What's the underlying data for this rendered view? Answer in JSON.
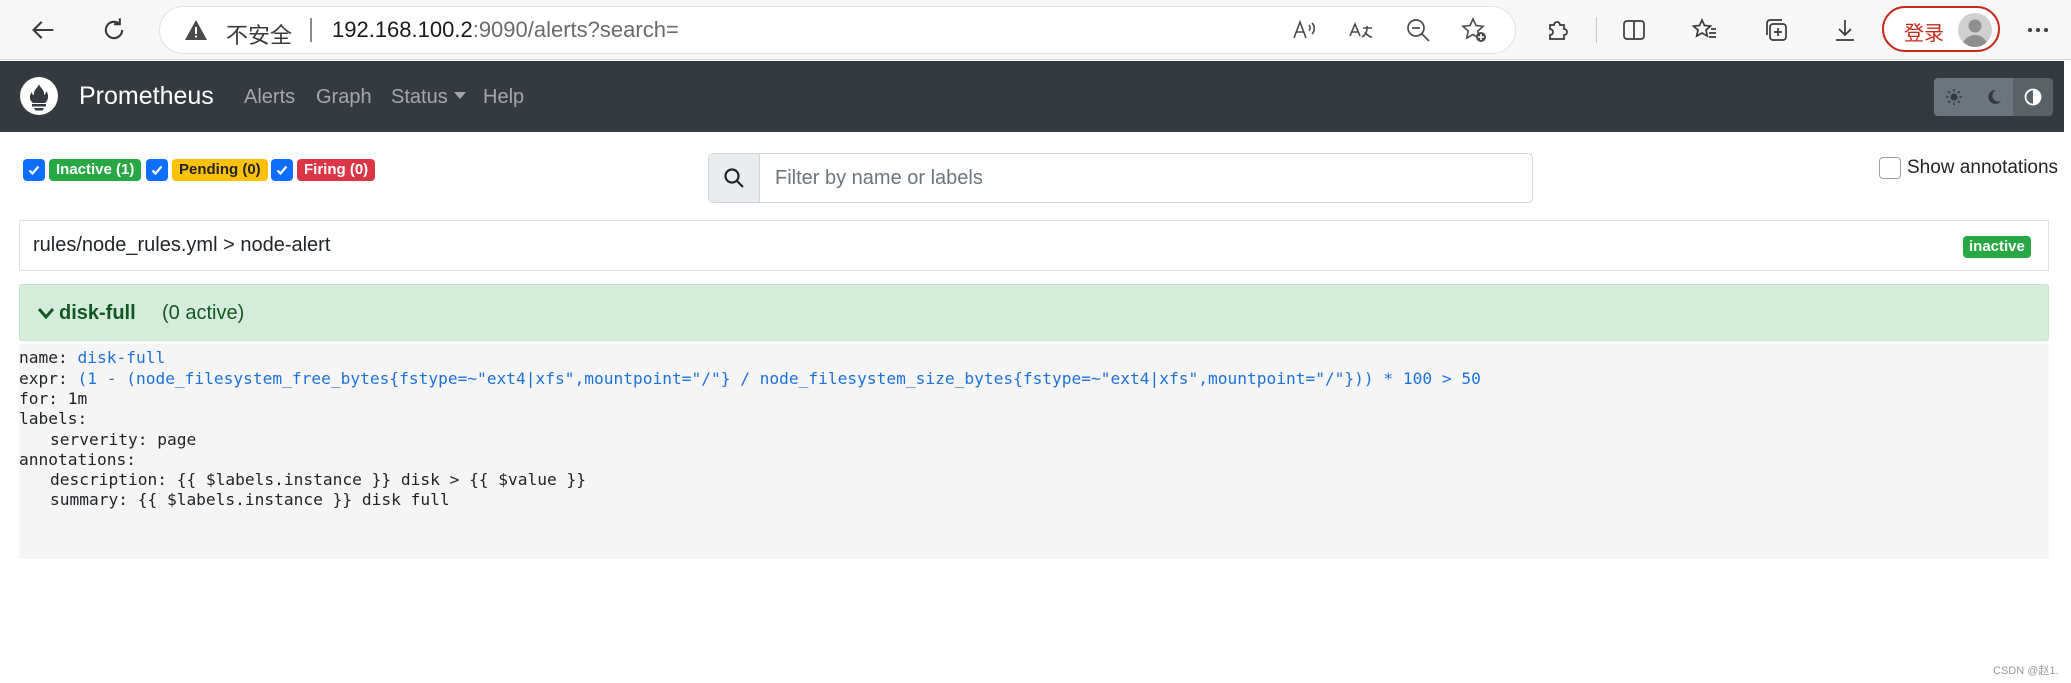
{
  "browser": {
    "insecure_label": "不安全",
    "url_host": "192.168.100.2",
    "url_rest": ":9090/alerts?search=",
    "login_label": "登录"
  },
  "navbar": {
    "brand": "Prometheus",
    "links": [
      "Alerts",
      "Graph",
      "Status",
      "Help"
    ]
  },
  "filters": {
    "inactive": "Inactive (1)",
    "pending": "Pending (0)",
    "firing": "Firing (0)",
    "search_placeholder": "Filter by name or labels",
    "search_value": "",
    "show_annotations": "Show annotations"
  },
  "group": {
    "path": "rules/node_rules.yml > node-alert",
    "state": "inactive"
  },
  "alert": {
    "name": "disk-full",
    "active": "(0 active)"
  },
  "rule": {
    "name_key": "name:",
    "name_value": "disk-full",
    "expr_key": "expr:",
    "expr_value": "(1 - (node_filesystem_free_bytes{fstype=~\"ext4|xfs\",mountpoint=\"/\"} / node_filesystem_size_bytes{fstype=~\"ext4|xfs\",mountpoint=\"/\"})) * 100 > 50",
    "for": "for: 1m",
    "labels_key": "labels:",
    "label_serverity": "serverity: page",
    "annotations_key": "annotations:",
    "annotation_description": "description: {{ $labels.instance }} disk > {{ $value }}",
    "annotation_summary": "summary: {{ $labels.instance }} disk full"
  },
  "watermark": "CSDN @赵1.",
  "colors": {
    "navbar": "#343a40",
    "success": "#28a745",
    "warning": "#ffc107",
    "danger": "#dc3545",
    "primary": "#0d6efd",
    "alert_bg": "#d4edda",
    "code_value": "#1d72d8"
  }
}
